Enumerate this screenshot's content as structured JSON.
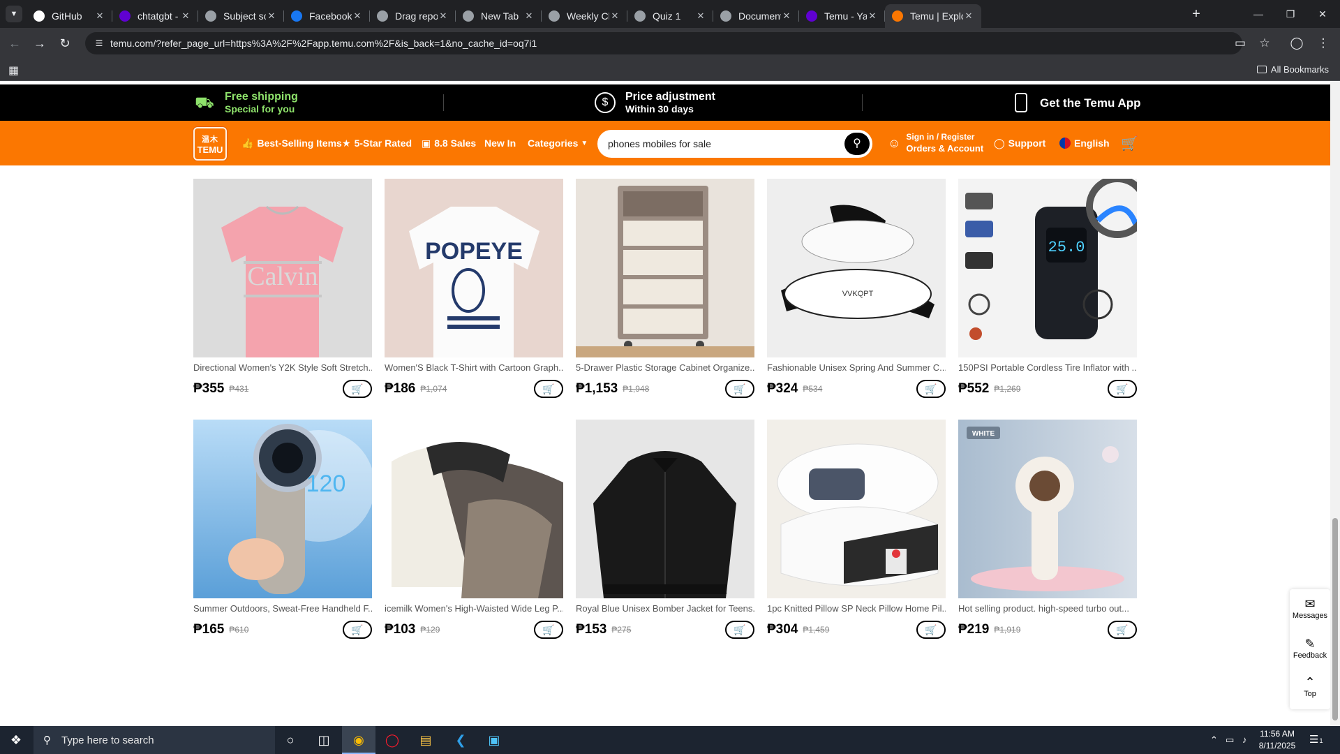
{
  "browser": {
    "tabs": [
      {
        "label": "GitHub",
        "icon": "github-icon",
        "fav": "#ffffff",
        "active": false
      },
      {
        "label": "chtatgbt - Yaho",
        "icon": "yahoo-icon",
        "fav": "#6001d2",
        "active": false
      },
      {
        "label": "Subject schedu",
        "icon": "globe-icon",
        "fav": "#9aa0a6",
        "active": false
      },
      {
        "label": "Facebook - log",
        "icon": "facebook-icon",
        "fav": "#1877f2",
        "active": false
      },
      {
        "label": "Drag repositor",
        "icon": "globe-icon",
        "fav": "#9aa0a6",
        "active": false
      },
      {
        "label": "New Tab",
        "icon": "globe-icon",
        "fav": "#9aa0a6",
        "active": false
      },
      {
        "label": "Weekly Class S",
        "icon": "globe-icon",
        "fav": "#9aa0a6",
        "active": false
      },
      {
        "label": "Quiz 1",
        "icon": "globe-icon",
        "fav": "#9aa0a6",
        "active": false
      },
      {
        "label": "Document",
        "icon": "globe-icon",
        "fav": "#9aa0a6",
        "active": false
      },
      {
        "label": "Temu - Yahoo S",
        "icon": "yahoo-icon",
        "fav": "#6001d2",
        "active": false
      },
      {
        "label": "Temu | Explore",
        "icon": "temu-icon",
        "fav": "#fb7701",
        "active": true
      }
    ],
    "url": "temu.com/?refer_page_url=https%3A%2F%2Fapp.temu.com%2F&is_back=1&no_cache_id=oq7i1",
    "all_bookmarks": "All Bookmarks"
  },
  "promo": {
    "shipping_title": "Free shipping",
    "shipping_sub": "Special for you",
    "price_title": "Price adjustment",
    "price_sub": "Within 30 days",
    "app_label": "Get the Temu App",
    "accent": "#8ee26b"
  },
  "nav": {
    "logo_top": "温木",
    "logo_bottom": "TEMU",
    "best_selling": "Best-Selling Items",
    "five_star": "5-Star Rated",
    "sales": "8.8 Sales",
    "new_in": "New In",
    "categories": "Categories",
    "search_value": "phones mobiles for sale",
    "signin_line1": "Sign in / Register",
    "signin_line2": "Orders & Account",
    "support": "Support",
    "language": "English",
    "brand_color": "#fb7701"
  },
  "products": [
    {
      "title": "Directional Women's Y2K Style Soft Stretch...",
      "price": "₱355",
      "old": "₱431"
    },
    {
      "title": "Women'S Black T-Shirt with Cartoon Graph...",
      "price": "₱186",
      "old": "₱1,074"
    },
    {
      "title": "5-Drawer Plastic Storage Cabinet Organize...",
      "price": "₱1,153",
      "old": "₱1,948"
    },
    {
      "title": "Fashionable Unisex Spring And Summer C...",
      "price": "₱324",
      "old": "₱534"
    },
    {
      "title": "150PSI Portable Cordless Tire Inflator with ...",
      "price": "₱552",
      "old": "₱1,269"
    },
    {
      "title": "Summer Outdoors, Sweat-Free Handheld F...",
      "price": "₱165",
      "old": "₱610"
    },
    {
      "title": "icemilk Women's High-Waisted Wide Leg P...",
      "price": "₱103",
      "old": "₱129"
    },
    {
      "title": "Royal Blue Unisex Bomber Jacket for Teens...",
      "price": "₱153",
      "old": "₱275"
    },
    {
      "title": "1pc Knitted Pillow SP Neck Pillow Home Pil...",
      "price": "₱304",
      "old": "₱1,459"
    },
    {
      "title": "Hot selling product. high-speed turbo out...",
      "price": "₱219",
      "old": "₱1,919"
    }
  ],
  "image_text": {
    "calvin": "Calvin",
    "popeye": "POPEYE",
    "slipper_brand": "VVKQPT",
    "inflator_display": "25.0",
    "fan_display": "120",
    "white_badge": "WHITE"
  },
  "float": {
    "messages": "Messages",
    "feedback": "Feedback",
    "top": "Top"
  },
  "taskbar": {
    "search_placeholder": "Type here to search",
    "time": "11:56 AM",
    "date": "8/11/2025",
    "notifications": "1"
  }
}
